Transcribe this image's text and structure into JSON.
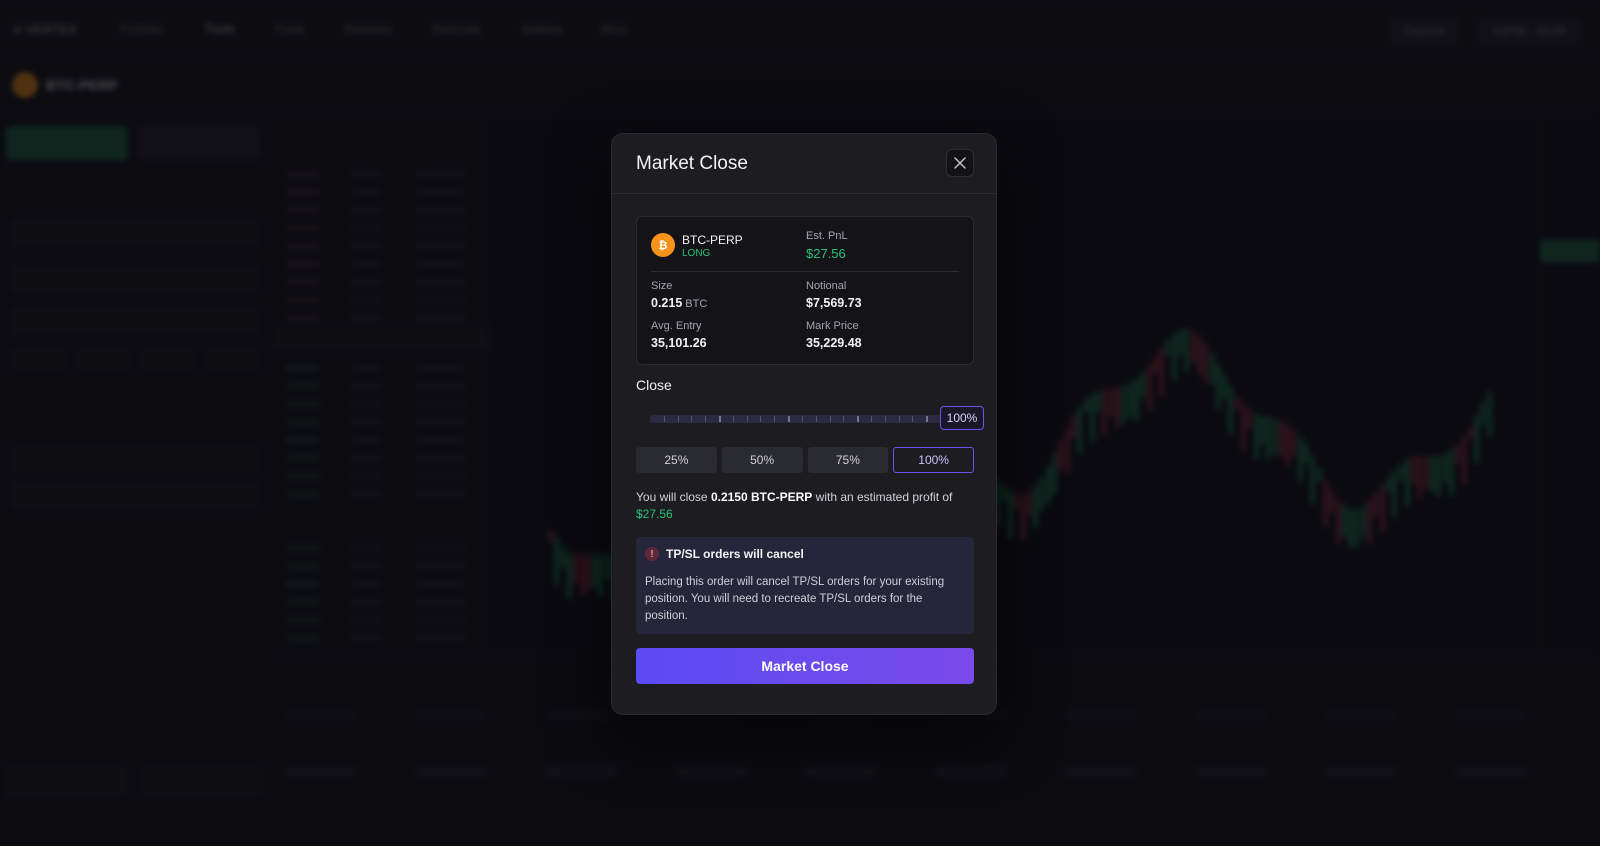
{
  "background": {
    "logo": "≡ VERTEX",
    "nav": [
      "Portfolio",
      "Trade",
      "Pools",
      "Rewards",
      "Referrals",
      "Staking",
      "More"
    ],
    "symbol": "BTC-PERP",
    "actions": [
      "Deposit",
      "0xF5E...6C49"
    ]
  },
  "modal": {
    "title": "Market Close",
    "position": {
      "symbol": "BTC-PERP",
      "side": "LONG",
      "pnl_label": "Est. PnL",
      "pnl_value": "$27.56",
      "size_label": "Size",
      "size_value": "0.215",
      "size_unit": "BTC",
      "notional_label": "Notional",
      "notional_value": "$7,569.73",
      "entry_label": "Avg. Entry",
      "entry_value": "35,101.26",
      "mark_label": "Mark Price",
      "mark_value": "35,229.48"
    },
    "close_label": "Close",
    "slider": {
      "value": 1.0,
      "display": "100%"
    },
    "percent_buttons": [
      "25%",
      "50%",
      "75%",
      "100%"
    ],
    "active_percent": "100%",
    "summary": {
      "prefix": "You will close ",
      "amount": "0.2150 BTC-PERP",
      "middle": " with an estimated profit of ",
      "profit": "$27.56"
    },
    "warning": {
      "title": "TP/SL orders will cancel",
      "text": "Placing this order will cancel TP/SL orders for your existing position. You will need to recreate TP/SL orders for the position."
    },
    "submit_label": "Market Close"
  },
  "colors": {
    "accent": "#6a55ef",
    "positive": "#29c07a",
    "bitcoin": "#f7931a"
  }
}
